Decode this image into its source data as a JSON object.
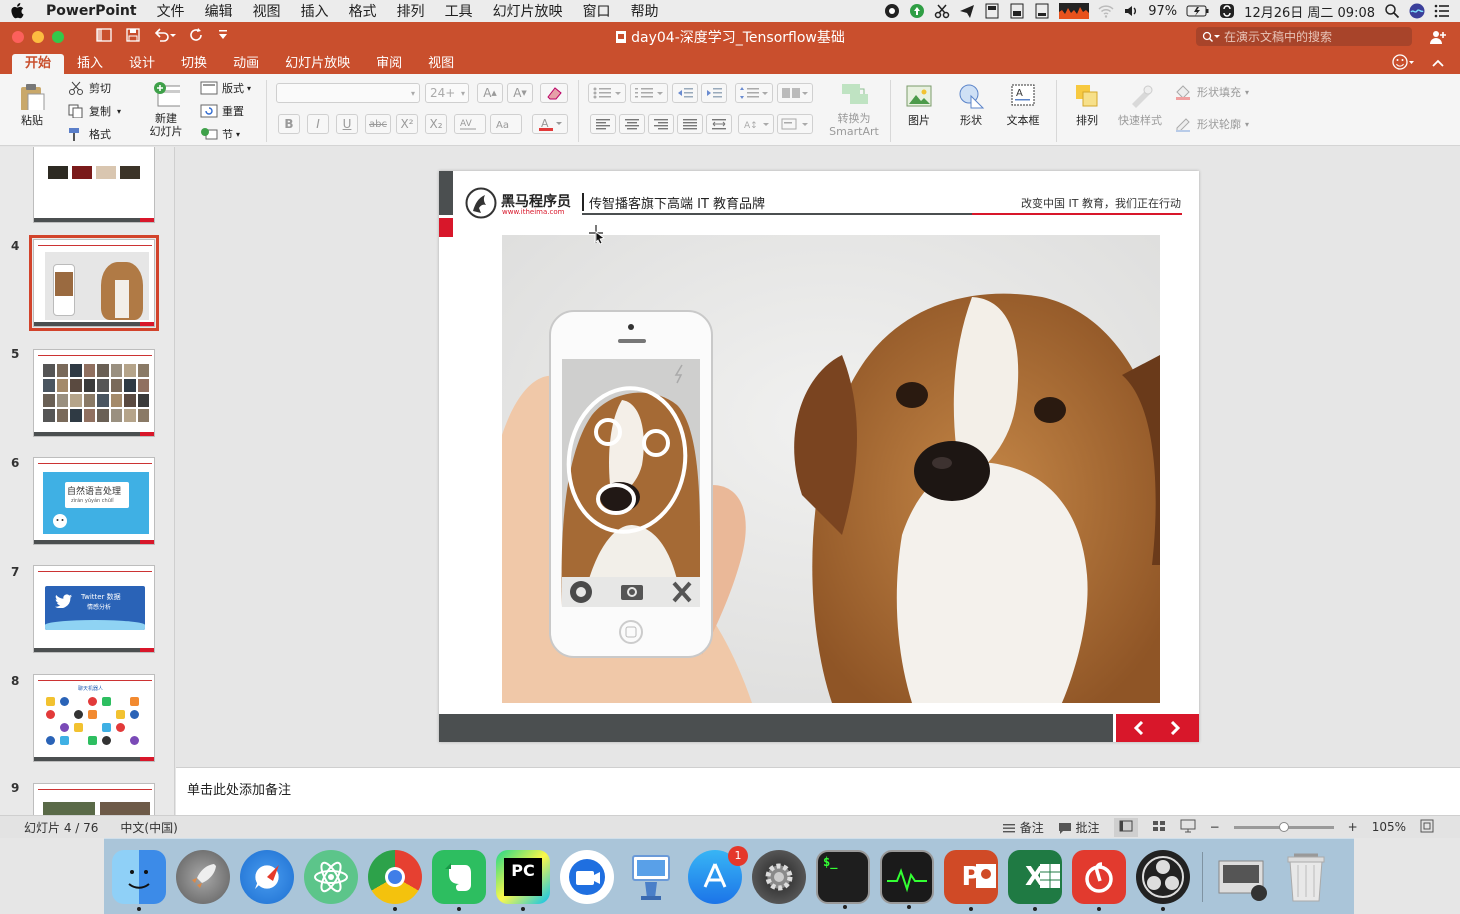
{
  "menubar": {
    "app_name": "PowerPoint",
    "items": [
      "文件",
      "编辑",
      "视图",
      "插入",
      "格式",
      "排列",
      "工具",
      "幻灯片放映",
      "窗口",
      "帮助"
    ],
    "battery": "97%",
    "datetime": "12月26日 周二 09:08"
  },
  "titlebar": {
    "doc_title": "day04-深度学习_Tensorflow基础",
    "search_placeholder": "在演示文稿中的搜索"
  },
  "tabs": [
    "开始",
    "插入",
    "设计",
    "切换",
    "动画",
    "幻灯片放映",
    "审阅",
    "视图"
  ],
  "ribbon": {
    "paste": "粘贴",
    "cut": "剪切",
    "copy": "复制",
    "format": "格式",
    "new_slide": "新建\n幻灯片",
    "layout": "版式",
    "reset": "重置",
    "section": "节",
    "font_size": "24+",
    "bold": "B",
    "italic": "I",
    "underline": "U",
    "strike": "abc",
    "superscript": "X²",
    "subscript": "X₂",
    "smartart": "转换为\nSmartArt",
    "picture": "图片",
    "shape": "形状",
    "textbox": "文本框",
    "arrange": "排列",
    "quick_styles": "快速样式",
    "shape_fill": "形状填充",
    "shape_outline": "形状轮廓"
  },
  "thumbnails": [
    {
      "num": "",
      "kind": "partial"
    },
    {
      "num": "4",
      "kind": "dog",
      "selected": true
    },
    {
      "num": "5",
      "kind": "grid"
    },
    {
      "num": "6",
      "kind": "nlp",
      "text": "自然语言处理",
      "sub": "zìrán yǔyán chǔlǐ"
    },
    {
      "num": "7",
      "kind": "twitter",
      "text": "Twitter 数据",
      "sub": "情感分析"
    },
    {
      "num": "8",
      "kind": "icons",
      "text": "聊天机器人"
    },
    {
      "num": "9",
      "kind": "partial-bottom"
    }
  ],
  "slide": {
    "logo_text": "黑马程序员",
    "logo_url": "www.itheima.com",
    "tagline": "传智播客旗下高端 IT 教育品牌",
    "slogan": "改变中国 IT 教育，我们正在行动"
  },
  "notes_placeholder": "单击此处添加备注",
  "status": {
    "slide_info": "幻灯片 4 / 76",
    "language": "中文(中国)",
    "notes": "备注",
    "comments": "批注",
    "zoom": "105%",
    "zoom_level": 0.5
  },
  "dock": {
    "apps": [
      "finder",
      "launchpad",
      "safari",
      "atom",
      "chrome",
      "evernote",
      "pycharm",
      "screenflow",
      "keynote",
      "app-store",
      "system-preferences",
      "terminal",
      "activity-monitor",
      "powerpoint",
      "excel",
      "netease-music",
      "obs",
      "screenshot-folder",
      "trash"
    ],
    "app_store_badge": "1",
    "pycharm_label": "PC",
    "terminal_label": "$_",
    "powerpoint_label": "P",
    "excel_label": "X"
  },
  "colors": {
    "accent": "#c94f2d",
    "brand_red": "#d8172a",
    "slide_gray": "#4b4f50"
  }
}
